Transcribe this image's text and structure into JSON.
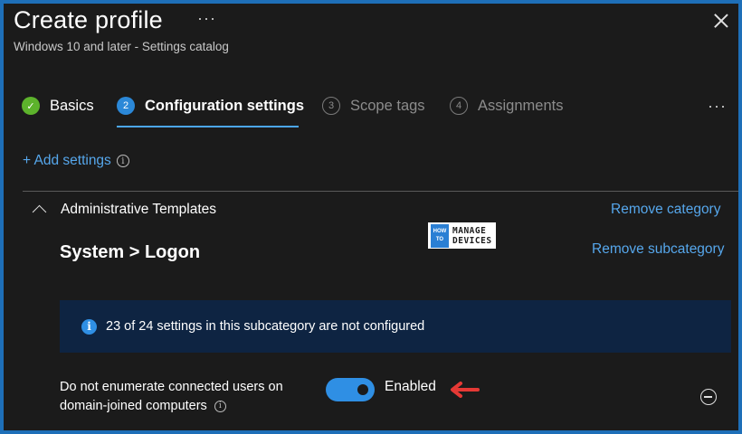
{
  "header": {
    "title": "Create profile",
    "more": "···",
    "subtitle": "Windows 10 and later - Settings catalog"
  },
  "tabs": [
    {
      "label": "Basics",
      "badge": "✓",
      "state": "done"
    },
    {
      "label": "Configuration settings",
      "badge": "2",
      "state": "active"
    },
    {
      "label": "Scope tags",
      "badge": "3",
      "state": "pending"
    },
    {
      "label": "Assignments",
      "badge": "4",
      "state": "pending"
    }
  ],
  "tabs_more": "···",
  "add_settings": {
    "label": "+ Add settings",
    "info": "i"
  },
  "category": {
    "label": "Administrative Templates",
    "remove_label": "Remove category",
    "subcategory_title": "System > Logon",
    "remove_sub_label": "Remove subcategory"
  },
  "watermark": {
    "how": "HOW",
    "to": "TO",
    "line1": "MANAGE",
    "line2": "DEVICES"
  },
  "banner": {
    "text": "23 of 24 settings in this subcategory are not configured"
  },
  "setting": {
    "label_line1": "Do not enumerate connected users on",
    "label_line2": "domain-joined computers",
    "state_label": "Enabled",
    "enabled": true
  },
  "colors": {
    "accent": "#2f8fe4",
    "link": "#56a7ec",
    "success": "#5db32c",
    "banner_bg": "#0e2442",
    "annotation_arrow": "#e53935"
  }
}
